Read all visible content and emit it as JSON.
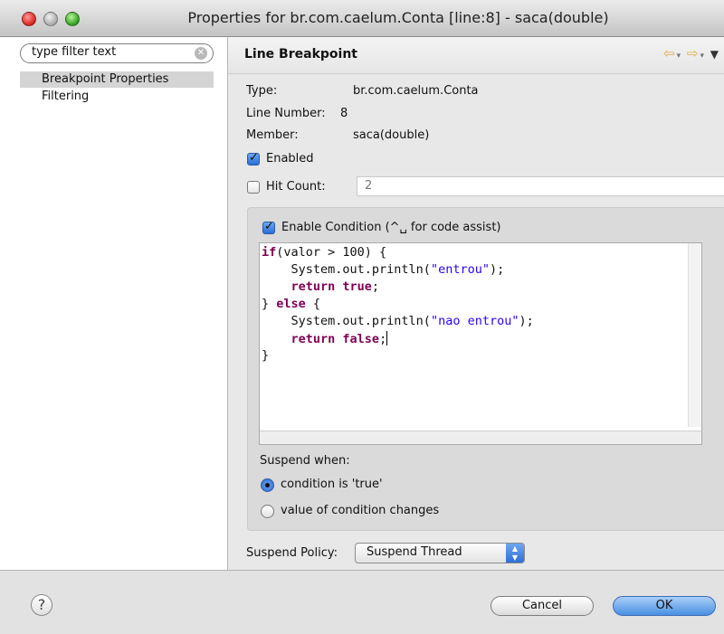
{
  "window": {
    "title": "Properties for br.com.caelum.Conta [line:8] - saca(double)"
  },
  "sidebar": {
    "filter_value": "type filter text",
    "items": [
      {
        "label": "Breakpoint Properties",
        "selected": true
      },
      {
        "label": "Filtering",
        "selected": false
      }
    ]
  },
  "page": {
    "title": "Line Breakpoint",
    "type_label": "Type:",
    "type_value": "br.com.caelum.Conta",
    "line_label": "Line Number:",
    "line_value": "8",
    "member_label": "Member:",
    "member_value": "saca(double)",
    "enabled_label": "Enabled",
    "enabled_checked": true,
    "hitcount_label": "Hit Count:",
    "hitcount_checked": false,
    "hitcount_value": "2",
    "condition_label": "Enable Condition (^␣ for code assist)",
    "condition_checked": true,
    "code_lines": [
      "if(valor > 100) {",
      "    System.out.println(\"entrou\");",
      "    return true;",
      "} else {",
      "    System.out.println(\"nao entrou\");",
      "    return false;",
      "}"
    ],
    "suspend_when_label": "Suspend when:",
    "radio_true_label": "condition is 'true'",
    "radio_changes_label": "value of condition changes",
    "selected_radio": "condition is 'true'",
    "suspend_policy_label": "Suspend Policy:",
    "suspend_policy_value": "Suspend Thread"
  },
  "footer": {
    "help": "?",
    "cancel": "Cancel",
    "ok": "OK"
  },
  "icons": [
    "back-arrow-icon",
    "forward-arrow-icon",
    "view-menu-icon",
    "clear-search-icon",
    "help-icon"
  ],
  "colors": {
    "keyword": "#7f0055",
    "string": "#2a00ff",
    "accent": "#2c6fd6"
  }
}
